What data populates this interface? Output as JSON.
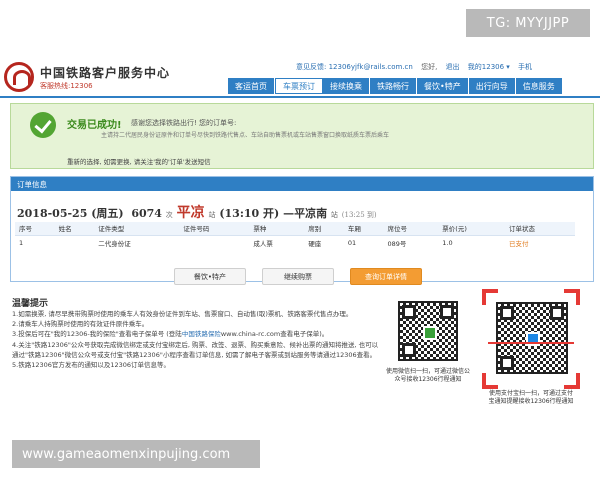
{
  "watermarks": {
    "top": "TG: MYYJJPP",
    "bottom": "www.gameaomenxinpujing.com"
  },
  "header": {
    "site_title": "中国铁路客户服务中心",
    "hotline": "客服热线:12306",
    "top_links": [
      "意见反馈: 12306yjfk@rails.com.cn",
      "您好,",
      "退出",
      "我的12306 ▾",
      "手机"
    ]
  },
  "nav": [
    "客运首页",
    "车票预订",
    "接续换乘",
    "铁路畅行",
    "餐饮•特产",
    "出行向导",
    "信息服务"
  ],
  "nav_active_index": 1,
  "success": {
    "title": "交易已成功!",
    "line1_prefix": "感谢您选择铁路出行! 您的订单号:",
    "line2": "主请持二代居民身份证原件和订单号尽快到铁路代售点、车站自助售票机或车站售票窗口换取纸质车票后乘车",
    "line3": "重新的选择, 如需更换, 请关注'我的'订单'发送短信"
  },
  "order": {
    "panel_title": "订单信息",
    "date": "2018-05-25",
    "weekday": "(周五)",
    "train": "6074",
    "train_suffix": "次",
    "from": "平凉",
    "from_suffix": "站",
    "depart_time": "(13:10 开)",
    "arrow": "—",
    "to": "平凉南",
    "to_suffix": "站",
    "arrive_time": "(13:25 到)",
    "columns": [
      "序号",
      "姓名",
      "证件类型",
      "证件号码",
      "票种",
      "席别",
      "车厢",
      "席位号",
      "票价(元)",
      "订单状态"
    ],
    "rows": [
      {
        "no": "1",
        "name": "",
        "id_type": "二代身份证",
        "id_no": "",
        "ticket_type": "成人票",
        "seat_class": "硬座",
        "car": "01",
        "seat_no": "089号",
        "price": "1.0",
        "status": "已支付"
      }
    ],
    "buttons": {
      "food": "餐饮•特产",
      "continue": "继续购票",
      "query": "查询订单详情"
    }
  },
  "tips": {
    "title": "温馨提示",
    "items": [
      "1.如需换票, 请尽早携带购票时使用的乘车人有效身份证件到车站、售票窗口、自动售(取)票机、铁路客票代售点办理。",
      "2.请乘车人持购票时使用的有效证件原件乘车。",
      "3.投保后可在\"我的12306-我的保险\"查看电子保单号 (登陆中国铁路保险www.china-rc.com查看电子保单)。",
      "4.关注\"铁路12306\"公众号获取完成微信绑定或支付宝绑定后, 购票、改签、退票、购买乘意险、候补出票的通知将推送, 也可以通过\"铁路12306\"微信公众号或支付宝\"铁路12306\"小程序查看订单信息, 如需了解电子客票或到站服务等请通过12306查看。",
      "5.铁路12306官方发布的通知以及12306订单信息等。"
    ],
    "highlight": "中国铁路保险"
  },
  "qr_wechat_caption": "使用微信扫一扫，可通过微信公众号接收12306行程通知",
  "qr_alipay_caption": "使用支付宝扫一扫，可通过支付宝通知提醒接收12306行程通知"
}
